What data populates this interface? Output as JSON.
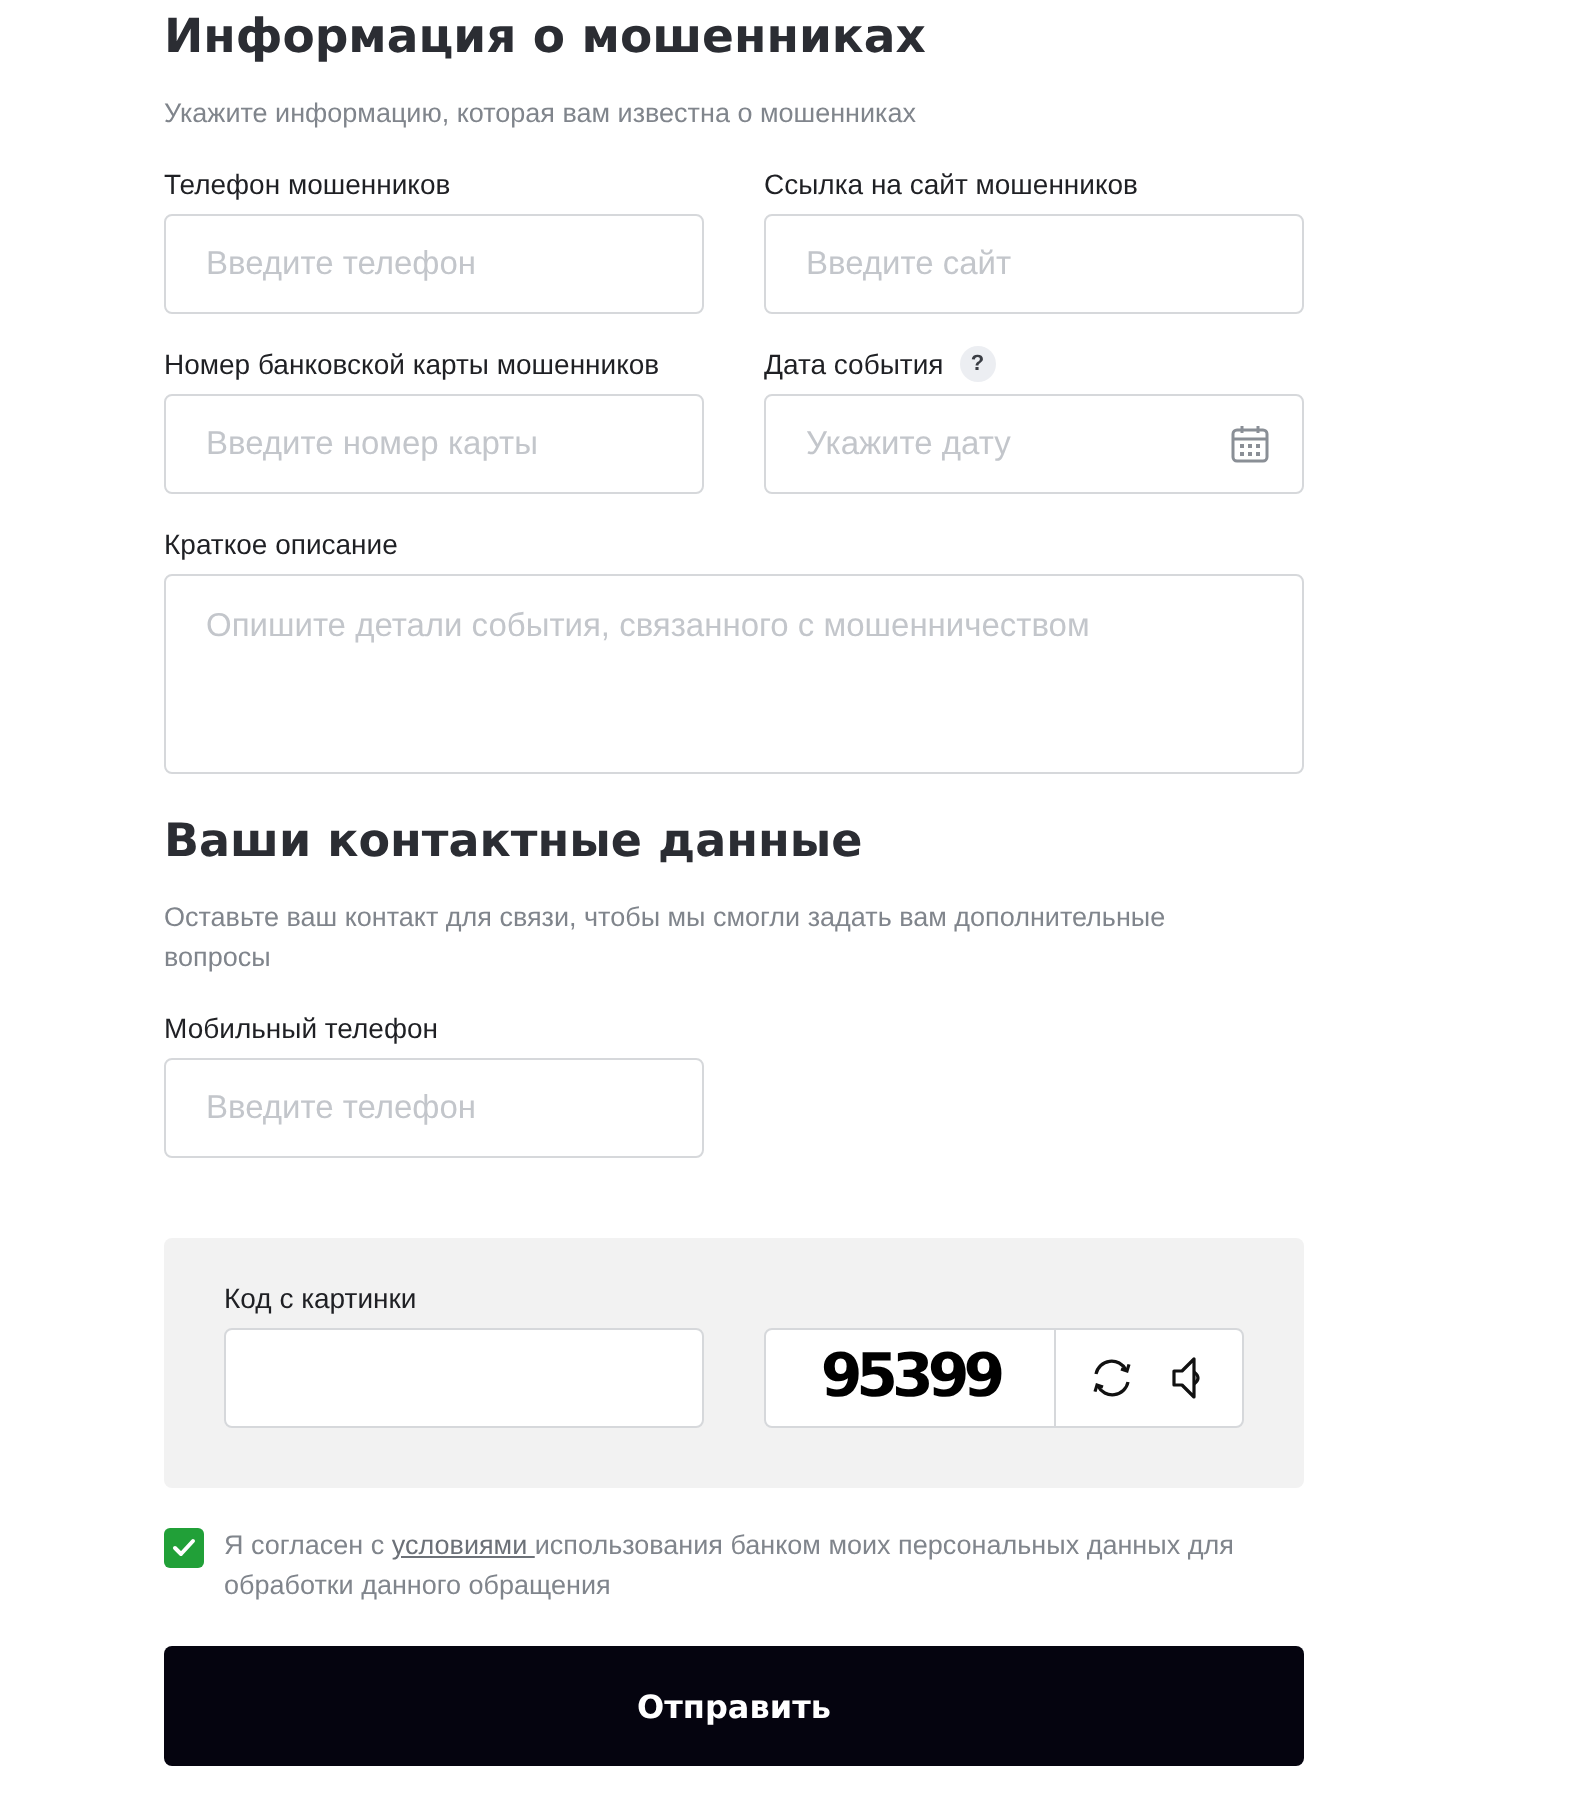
{
  "sections": [
    {
      "title": "Информация о мошенниках",
      "subtitle": "Укажите информацию, которая вам известна о мошенниках",
      "fields": [
        {
          "kind": "input",
          "label": "Телефон мошенников",
          "placeholder": "Введите телефон"
        },
        {
          "kind": "input",
          "label": "Ссылка на сайт мошенников",
          "placeholder": "Введите сайт"
        },
        {
          "kind": "input",
          "label": "Номер банковской карты мошенников",
          "placeholder": "Введите номер карты"
        },
        {
          "kind": "date",
          "label": "Дата события",
          "help": "?",
          "placeholder": "Укажите дату"
        },
        {
          "kind": "textarea",
          "label": "Краткое описание",
          "placeholder": "Опишите детали события, связанного с мошенничеством"
        }
      ]
    },
    {
      "title": "Ваши контактные данные",
      "subtitle": "Оставьте ваш контакт для связи, чтобы мы смогли задать вам дополнительные вопросы",
      "fields": [
        {
          "kind": "input",
          "label": "Мобильный телефон",
          "placeholder": "Введите телефон"
        }
      ]
    }
  ],
  "captcha": {
    "label": "Код с картинки",
    "code": "95399"
  },
  "consent": {
    "checked": true,
    "text_before": "Я согласен с ",
    "link": "условиями ",
    "text_after": "использования банком моих персональных данных для обработки данного обращения"
  },
  "submit_button": "Отправить"
}
